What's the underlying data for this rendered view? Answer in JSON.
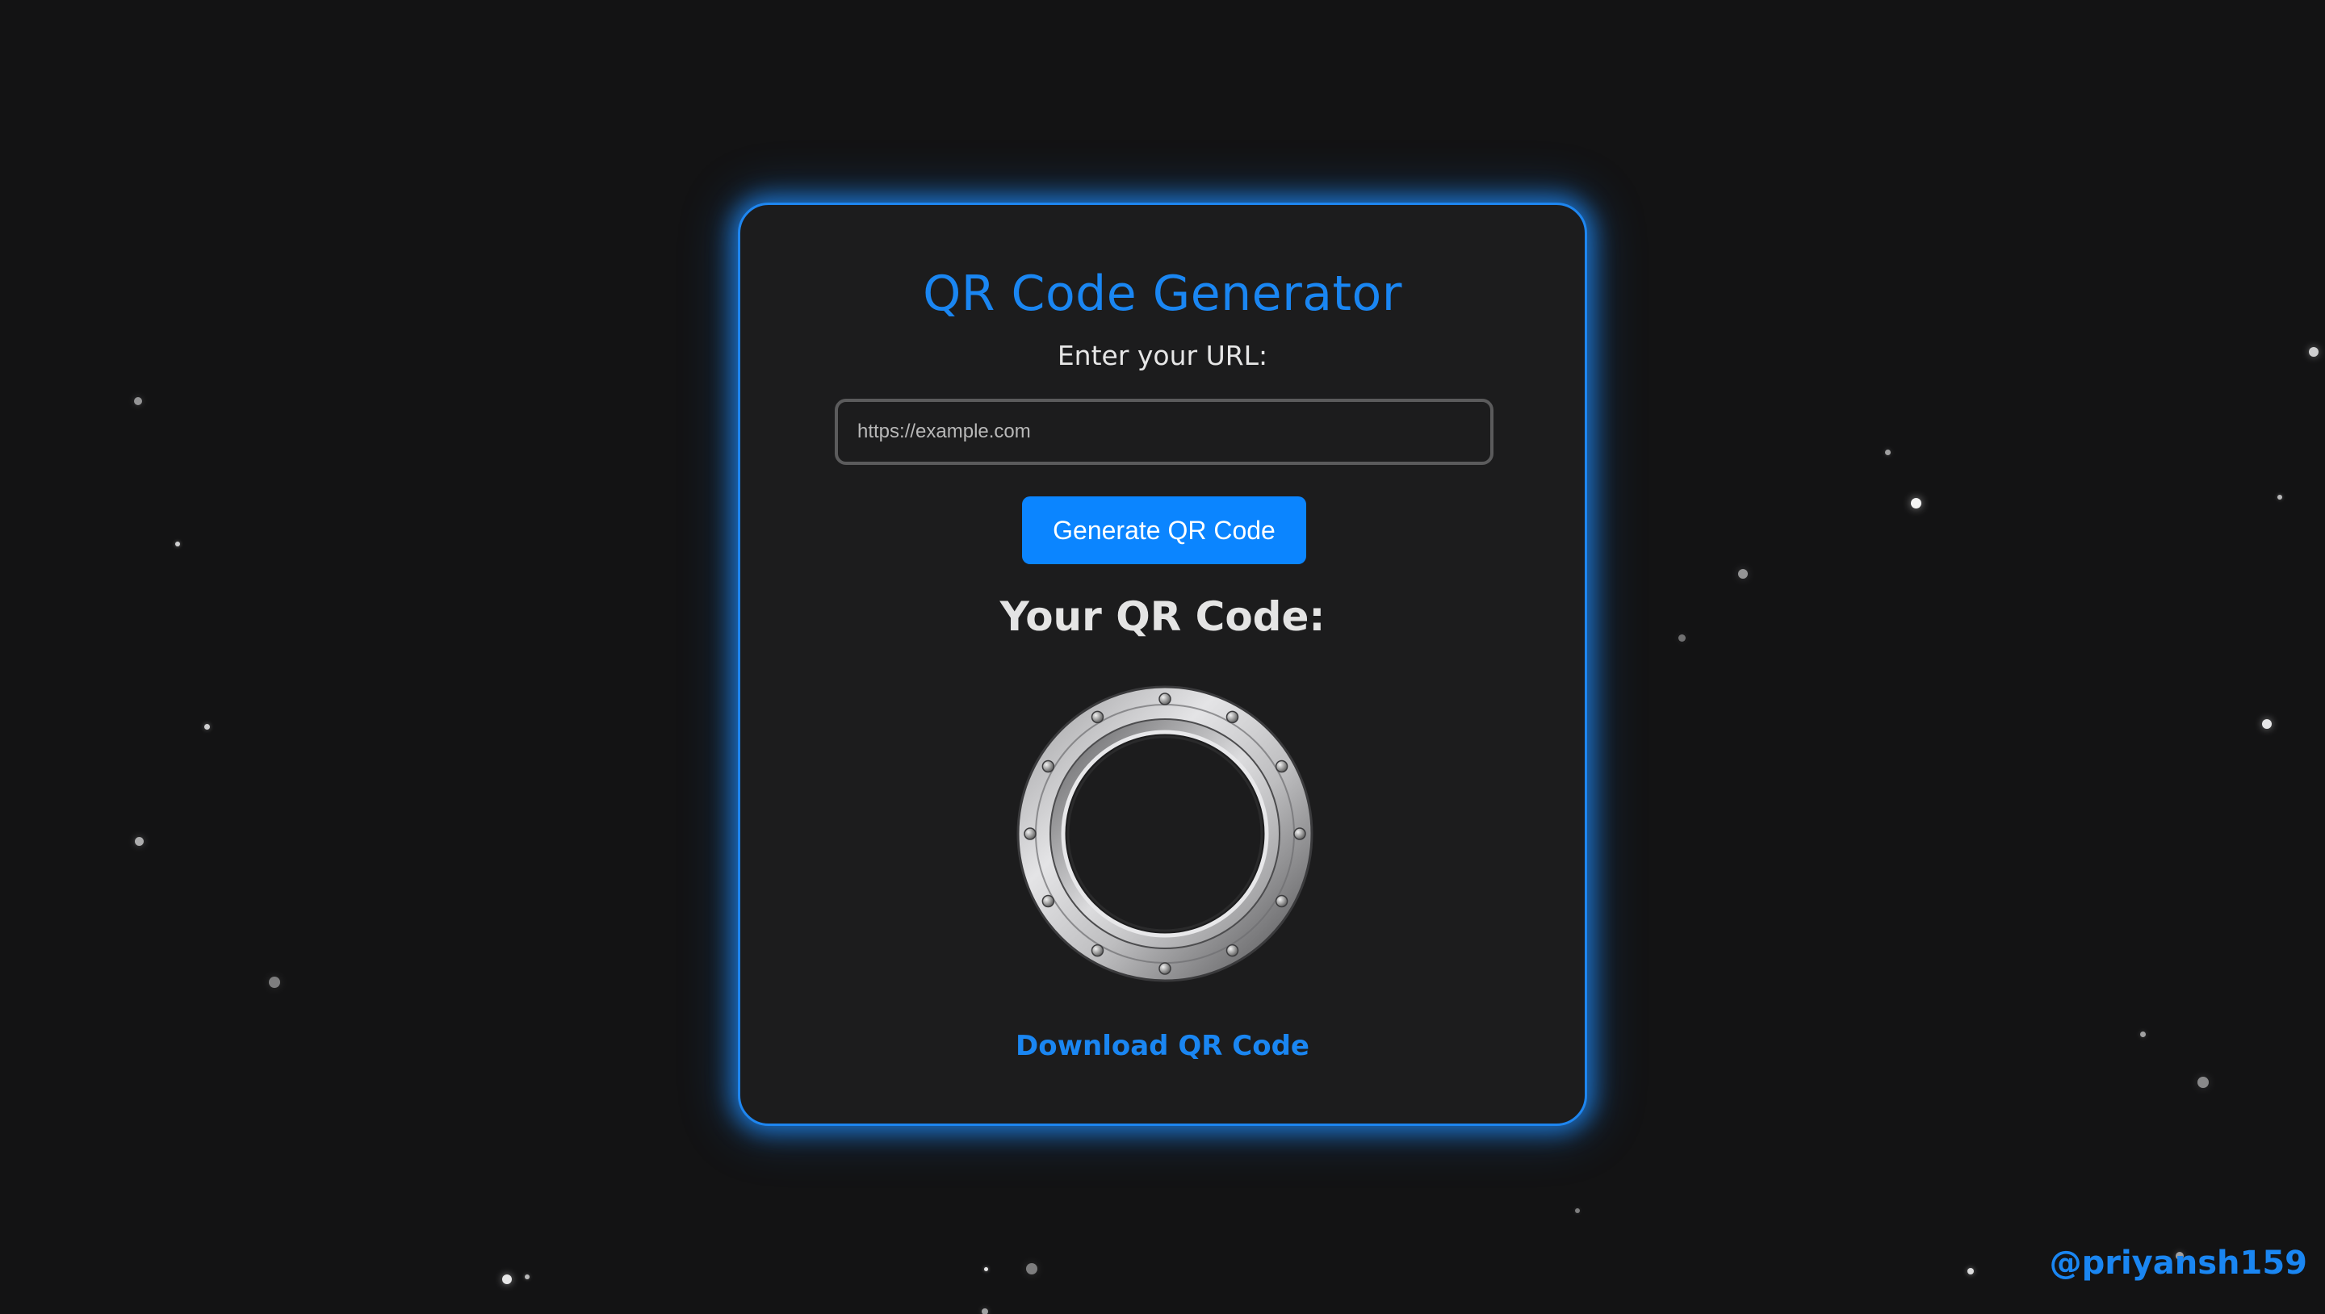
{
  "app": {
    "title": "QR Code Generator",
    "accent_color": "#1a86f2",
    "background_color": "#131314"
  },
  "form": {
    "label": "Enter your URL:",
    "url_placeholder": "https://example.com",
    "url_value": "",
    "generate_button_label": "Generate QR Code"
  },
  "result": {
    "heading": "Your QR Code:",
    "image_icon": "porthole-icon",
    "download_label": "Download QR Code"
  },
  "footer": {
    "handle": "@priyansh159"
  }
}
